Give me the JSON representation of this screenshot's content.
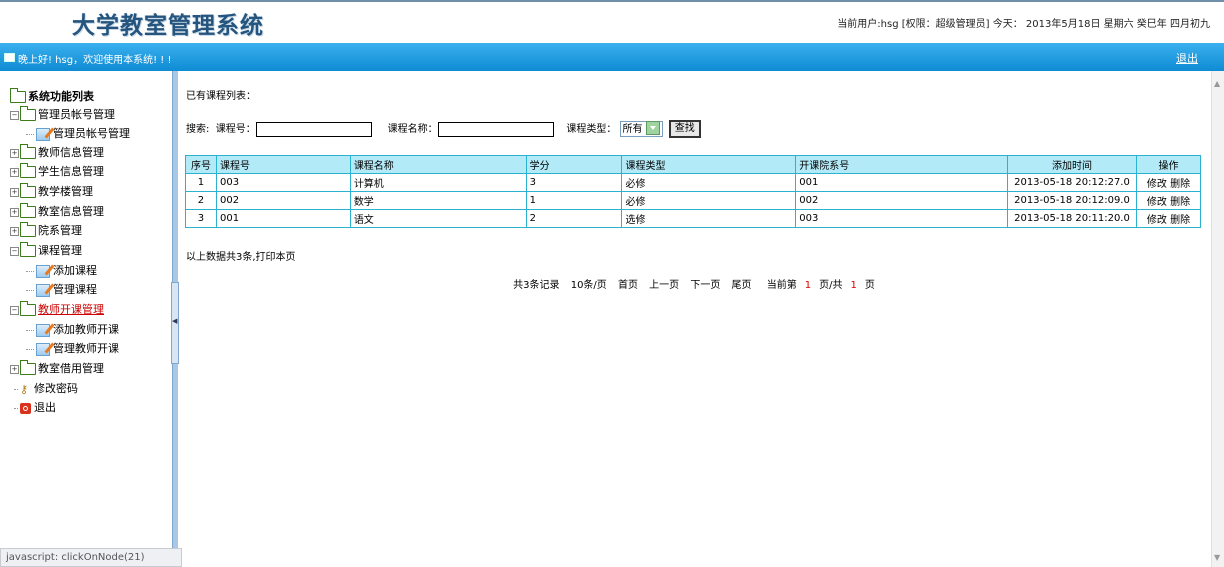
{
  "header": {
    "title": "大学教室管理系统",
    "user_info": "当前用户:hsg [权限：超级管理员] 今天： 2013年5月18日 星期六 癸巳年 四月初九"
  },
  "bar": {
    "greeting": "晚上好! hsg，欢迎使用本系统! ! !",
    "logout": "退出"
  },
  "sidebar": {
    "root": "系统功能列表",
    "items": [
      {
        "label": "管理员帐号管理"
      },
      {
        "label": "管理员帐号管理"
      },
      {
        "label": "教师信息管理"
      },
      {
        "label": "学生信息管理"
      },
      {
        "label": "教学楼管理"
      },
      {
        "label": "教室信息管理"
      },
      {
        "label": "院系管理"
      },
      {
        "label": "课程管理"
      },
      {
        "label": "添加课程"
      },
      {
        "label": "管理课程"
      },
      {
        "label": "教师开课管理"
      },
      {
        "label": "添加教师开课"
      },
      {
        "label": "管理教师开课"
      },
      {
        "label": "教室借用管理"
      },
      {
        "label": "修改密码"
      },
      {
        "label": "退出"
      }
    ]
  },
  "statusbar": "javascript: clickOnNode(21)",
  "content": {
    "list_title": "已有课程列表：",
    "search": {
      "label": "搜索:",
      "course_no_label": "课程号：",
      "course_name_label": "课程名称：",
      "course_type_label": "课程类型：",
      "type_value": "所有",
      "button": "查找"
    },
    "table": {
      "headers": [
        "序号",
        "课程号",
        "课程名称",
        "学分",
        "课程类型",
        "开课院系号",
        "添加时间",
        "操作"
      ],
      "rows": [
        {
          "no": "1",
          "code": "003",
          "name": "计算机",
          "credit": "3",
          "type": "必修",
          "dept": "001",
          "time": "2013-05-18 20:12:27.0",
          "edit": "修改",
          "delete": "删除"
        },
        {
          "no": "2",
          "code": "002",
          "name": "数学",
          "credit": "1",
          "type": "必修",
          "dept": "002",
          "time": "2013-05-18 20:12:09.0",
          "edit": "修改",
          "delete": "删除"
        },
        {
          "no": "3",
          "code": "001",
          "name": "语文",
          "credit": "2",
          "type": "选修",
          "dept": "003",
          "time": "2013-05-18 20:11:20.0",
          "edit": "修改",
          "delete": "删除"
        }
      ]
    },
    "summary": "以上数据共3条,打印本页",
    "pager": {
      "records": "共3条记录",
      "per_page": "10条/页",
      "first": "首页",
      "prev": "上一页",
      "next": "下一页",
      "last": "尾页",
      "current_pre": "当前第",
      "current_num": "1",
      "current_mid": "页/共",
      "total_num": "1",
      "current_post": "页"
    }
  }
}
